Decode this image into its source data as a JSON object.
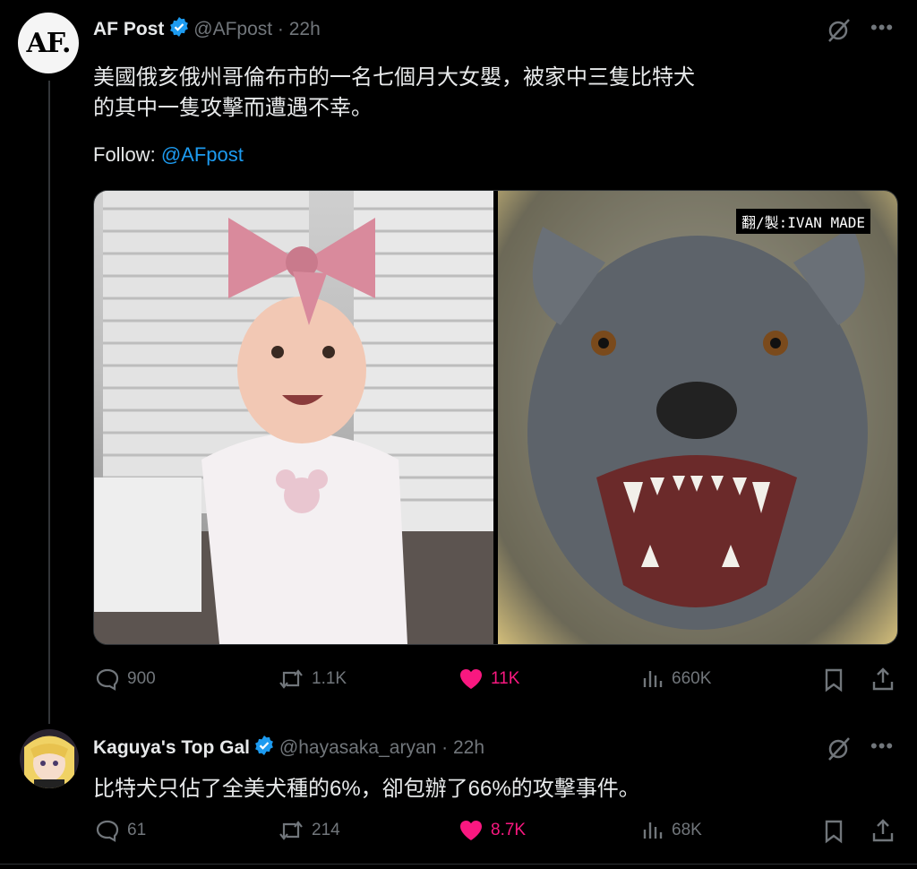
{
  "tweets": [
    {
      "avatar_text": "AF.",
      "name": "AF Post",
      "handle": "@AFpost · 22h",
      "text_line1": "美國俄亥俄州哥倫布市的一名七個月大女嬰，被家中三隻比特犬",
      "text_line2": "的其中一隻攻擊而遭遇不幸。",
      "follow_label": "Follow:",
      "follow_handle": "@AFpost",
      "media_credit": "翻/製:IVAN MADE",
      "stats": {
        "replies": "900",
        "reposts": "1.1K",
        "likes": "11K",
        "views": "660K"
      }
    },
    {
      "name": "Kaguya's Top Gal",
      "handle": "@hayasaka_aryan · 22h",
      "text": "比特犬只佔了全美犬種的6%，卻包辦了66%的攻擊事件。",
      "stats": {
        "replies": "61",
        "reposts": "214",
        "likes": "8.7K",
        "views": "68K"
      }
    }
  ],
  "colors": {
    "accent": "#1d9bf0",
    "like": "#f91880",
    "muted": "#71767b",
    "verified": "#1d9bf0"
  }
}
